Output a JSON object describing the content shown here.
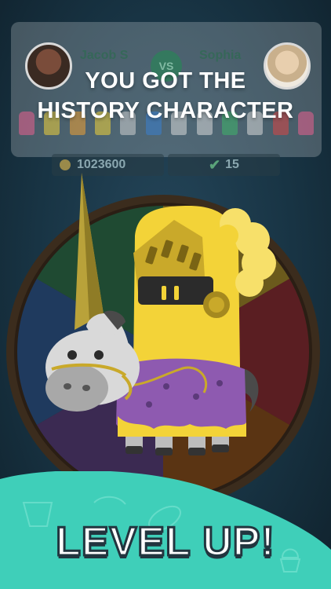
{
  "match": {
    "player_left": {
      "name": "Jacob S"
    },
    "player_right": {
      "name": "Sophia"
    },
    "vs_label": "VS"
  },
  "banner": {
    "line1": "YOU GOT THE",
    "line2": "HISTORY CHARACTER"
  },
  "stats": {
    "coins": "1023600",
    "streak": "15"
  },
  "footer": {
    "headline": "LEVEL UP!"
  },
  "colors": {
    "banner_text": "#ffffff",
    "wave": "#3fcfb9",
    "history_yellow": "#f3d338",
    "purple_cloak": "#8e5ab0"
  },
  "icons": [
    "coin-icon",
    "checkmark-icon",
    "cake-icon",
    "football-icon",
    "book-icon"
  ]
}
